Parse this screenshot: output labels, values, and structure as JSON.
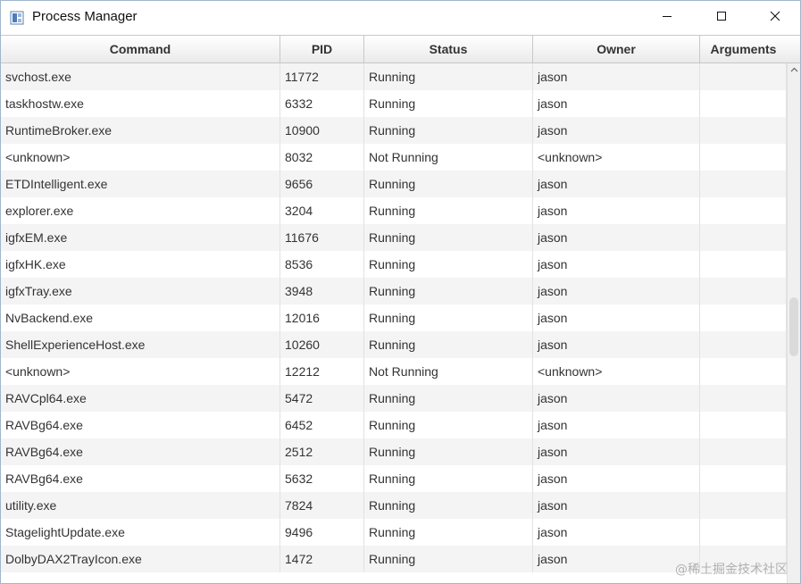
{
  "window": {
    "title": "Process Manager",
    "icon": "app-icon",
    "controls": {
      "minimize": "minimize-icon",
      "maximize": "maximize-icon",
      "close": "close-icon"
    }
  },
  "table": {
    "columns": [
      "Command",
      "PID",
      "Status",
      "Owner",
      "Arguments"
    ],
    "rows": [
      [
        "svchost.exe",
        "11772",
        "Running",
        "jason",
        ""
      ],
      [
        "taskhostw.exe",
        "6332",
        "Running",
        "jason",
        ""
      ],
      [
        "RuntimeBroker.exe",
        "10900",
        "Running",
        "jason",
        ""
      ],
      [
        "<unknown>",
        "8032",
        "Not Running",
        "<unknown>",
        ""
      ],
      [
        "ETDIntelligent.exe",
        "9656",
        "Running",
        "jason",
        ""
      ],
      [
        "explorer.exe",
        "3204",
        "Running",
        "jason",
        ""
      ],
      [
        "igfxEM.exe",
        "11676",
        "Running",
        "jason",
        ""
      ],
      [
        "igfxHK.exe",
        "8536",
        "Running",
        "jason",
        ""
      ],
      [
        "igfxTray.exe",
        "3948",
        "Running",
        "jason",
        ""
      ],
      [
        "NvBackend.exe",
        "12016",
        "Running",
        "jason",
        ""
      ],
      [
        "ShellExperienceHost.exe",
        "10260",
        "Running",
        "jason",
        ""
      ],
      [
        "<unknown>",
        "12212",
        "Not Running",
        "<unknown>",
        ""
      ],
      [
        "RAVCpl64.exe",
        "5472",
        "Running",
        "jason",
        ""
      ],
      [
        "RAVBg64.exe",
        "6452",
        "Running",
        "jason",
        ""
      ],
      [
        "RAVBg64.exe",
        "2512",
        "Running",
        "jason",
        ""
      ],
      [
        "RAVBg64.exe",
        "5632",
        "Running",
        "jason",
        ""
      ],
      [
        "utility.exe",
        "7824",
        "Running",
        "jason",
        ""
      ],
      [
        "StagelightUpdate.exe",
        "9496",
        "Running",
        "jason",
        ""
      ],
      [
        "DolbyDAX2TrayIcon.exe",
        "1472",
        "Running",
        "jason",
        ""
      ]
    ]
  },
  "watermark": "@稀土掘金技术社区"
}
